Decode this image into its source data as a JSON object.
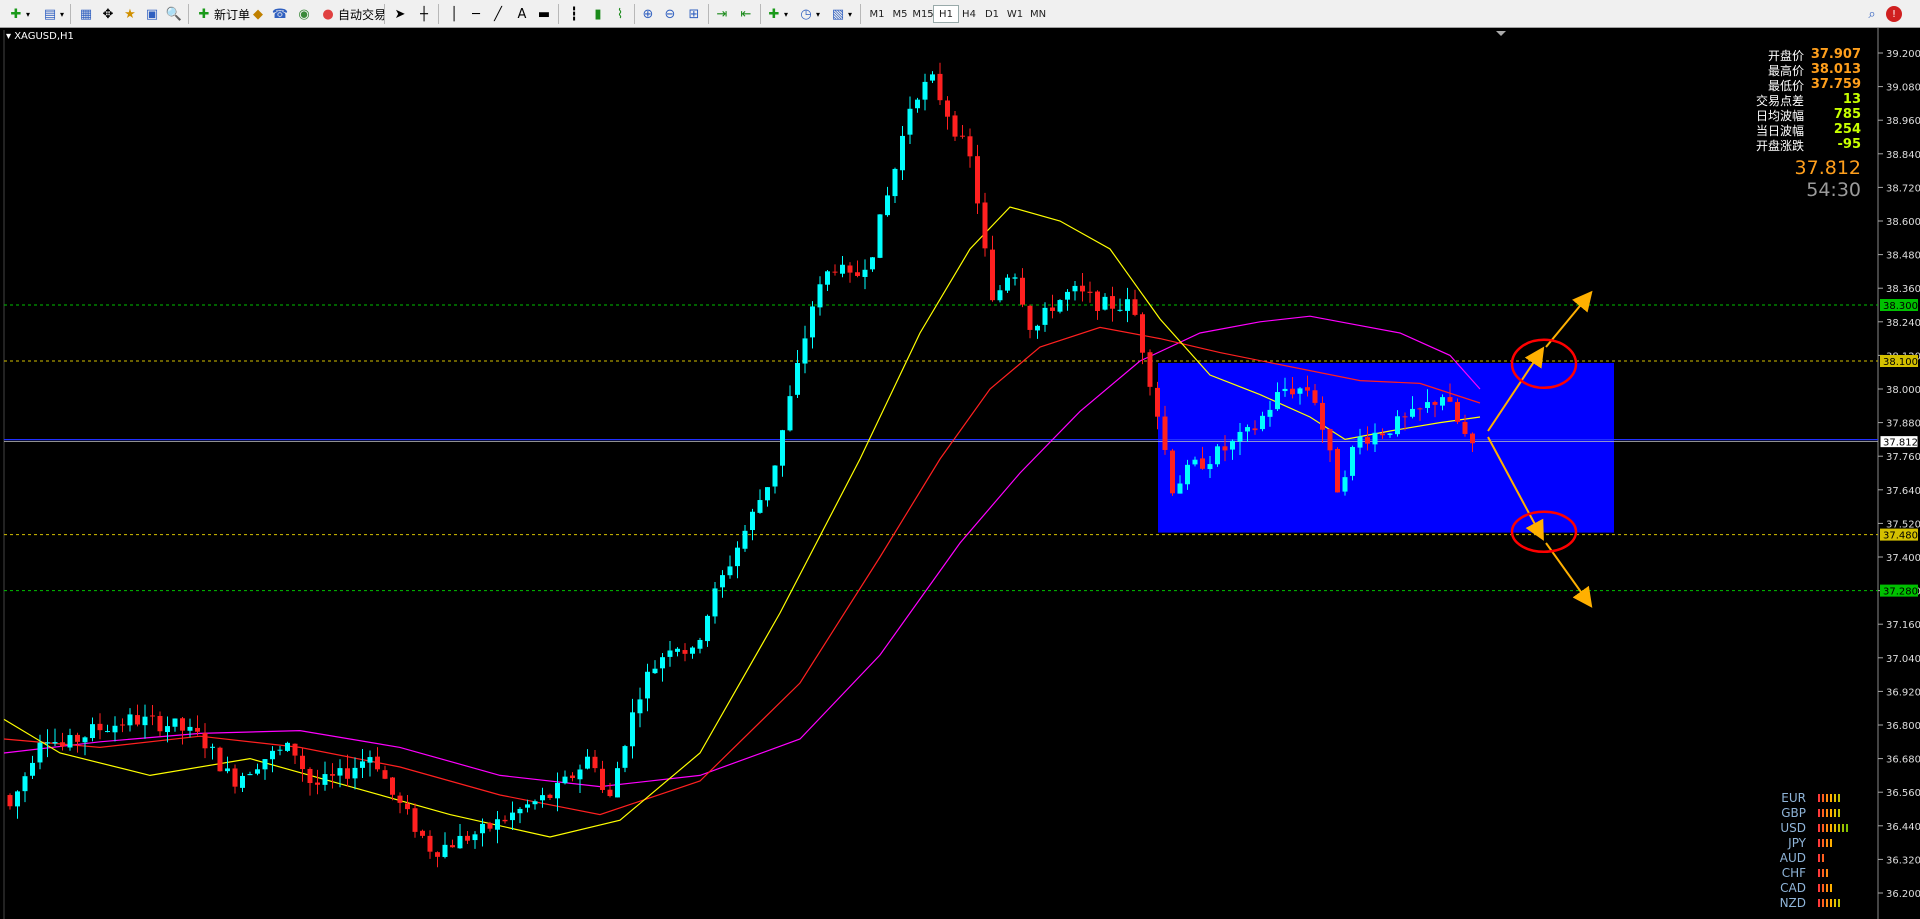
{
  "toolbar": {
    "new_order_label": "新订单",
    "auto_trade_label": "自动交易",
    "line_text_tool": "A",
    "timeframes": [
      "M1",
      "M5",
      "M15",
      "H1",
      "H4",
      "D1",
      "W1",
      "MN"
    ],
    "active_timeframe": "H1"
  },
  "chart": {
    "symbol_label": "XAGUSD,H1",
    "price_axis_ticks": [
      "39.200",
      "39.080",
      "38.960",
      "38.840",
      "38.720",
      "38.600",
      "38.480",
      "38.360",
      "38.240",
      "38.120",
      "38.000",
      "37.880",
      "37.760",
      "37.640",
      "37.520",
      "37.400",
      "37.280",
      "37.160",
      "37.040",
      "36.920",
      "36.800",
      "36.680",
      "36.560",
      "36.440",
      "36.320",
      "36.200"
    ],
    "price_labels": [
      {
        "text": "38.300",
        "color": "#00c000"
      },
      {
        "text": "38.100",
        "color": "#d4c000"
      },
      {
        "text": "37.812",
        "color": "#ffffff"
      },
      {
        "text": "37.480",
        "color": "#d4c000"
      },
      {
        "text": "37.280",
        "color": "#00c000"
      }
    ],
    "bid_line_price": "37.812"
  },
  "info_panel": {
    "rows": [
      {
        "label": "开盘价",
        "value": "37.907",
        "color": "#ff9f1c"
      },
      {
        "label": "最高价",
        "value": "38.013",
        "color": "#ff9f1c"
      },
      {
        "label": "最低价",
        "value": "37.759",
        "color": "#ff9f1c"
      },
      {
        "label": "交易点差",
        "value": "13",
        "color": "#c8ff00"
      },
      {
        "label": "日均波幅",
        "value": "785",
        "color": "#c8ff00"
      },
      {
        "label": "当日波幅",
        "value": "254",
        "color": "#c8ff00"
      },
      {
        "label": "开盘涨跌",
        "value": "-95",
        "color": "#c8ff00"
      }
    ],
    "current_price": "37.812",
    "countdown": "54:30"
  },
  "currency_strength": {
    "items": [
      {
        "name": "EUR",
        "level": 6
      },
      {
        "name": "GBP",
        "level": 6
      },
      {
        "name": "USD",
        "level": 8
      },
      {
        "name": "JPY",
        "level": 4
      },
      {
        "name": "AUD",
        "level": 2
      },
      {
        "name": "CHF",
        "level": 3
      },
      {
        "name": "CAD",
        "level": 4
      },
      {
        "name": "NZD",
        "level": 6
      }
    ]
  },
  "colors": {
    "bull_candle": "#00ffff",
    "bear_candle": "#ff2020",
    "box": "#0000ff",
    "ma_fast": "#ffff00",
    "ma_mid": "#ff2020",
    "ma_slow": "#ff00ff",
    "arrow": "#ffb000",
    "circle": "#ff0000"
  }
}
